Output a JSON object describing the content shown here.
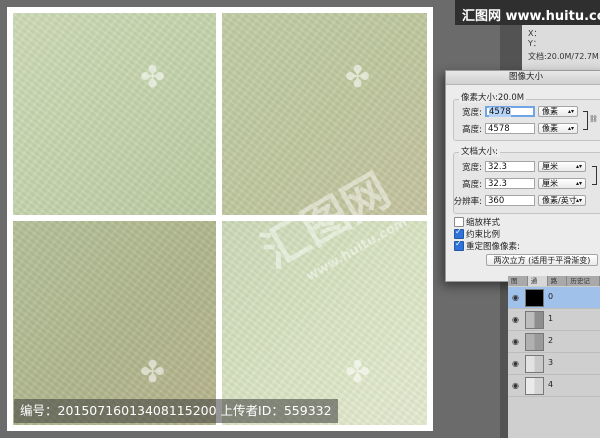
{
  "site": {
    "logo_text": "汇图网 www.huitu.com",
    "watermark_big": "汇图网",
    "watermark_url": "www.huitu.com"
  },
  "caption": {
    "text": "编号：20150716013408115200 上传者ID：559332"
  },
  "info_panel": {
    "x_label": "X：",
    "y_label": "Y：",
    "doc_size": "文档:20.0M/72.7M"
  },
  "dialog": {
    "title": "图像大小",
    "pixel_dimensions": {
      "label": "像素大小:20.0M",
      "width_label": "宽度:",
      "width_value": "4578",
      "width_unit": "像素",
      "height_label": "高度:",
      "height_value": "4578",
      "height_unit": "像素"
    },
    "document_size": {
      "label": "文档大小:",
      "width_label": "宽度:",
      "width_value": "32.3",
      "width_unit": "厘米",
      "height_label": "高度:",
      "height_value": "32.3",
      "height_unit": "厘米",
      "resolution_label": "分辨率:",
      "resolution_value": "360",
      "resolution_unit": "像素/英寸"
    },
    "options": {
      "scale_styles_label": "缩放样式",
      "scale_styles_checked": false,
      "constrain_label": "约束比例",
      "constrain_checked": true,
      "resample_label": "重定图像像素:",
      "resample_checked": true,
      "resample_method": "两次立方 (适用于平滑渐变)"
    }
  },
  "layers_panel": {
    "tabs": [
      "图层",
      "通道",
      "路径",
      "历史记录"
    ],
    "active_tab": 1,
    "rows": [
      {
        "name": "0"
      },
      {
        "name": "1"
      },
      {
        "name": "2"
      },
      {
        "name": "3"
      },
      {
        "name": "4"
      }
    ]
  },
  "colors": {
    "selection": "#9fc1ea",
    "accent": "#2f73d8"
  }
}
